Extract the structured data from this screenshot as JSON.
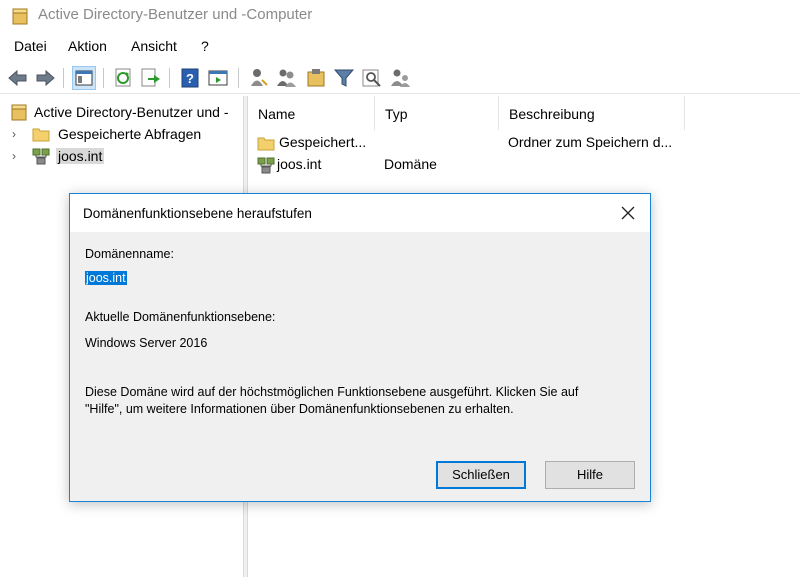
{
  "window": {
    "title": "Active Directory-Benutzer und -Computer"
  },
  "menu": {
    "items": [
      "Datei",
      "Aktion",
      "Ansicht",
      "?"
    ]
  },
  "toolbar": {
    "buttons": [
      "back-icon",
      "forward-icon",
      "show-console-tree-icon",
      "refresh-icon",
      "export-list-icon",
      "help-icon",
      "show-action-pane-icon",
      "create-user-icon",
      "create-group-icon",
      "create-ou-icon",
      "filter-icon",
      "find-icon",
      "add-to-group-icon"
    ]
  },
  "tree": {
    "root": "Active Directory-Benutzer und -",
    "items": [
      {
        "label": "Gespeicherte Abfragen"
      },
      {
        "label": "joos.int"
      }
    ]
  },
  "list": {
    "columns": [
      "Name",
      "Typ",
      "Beschreibung"
    ],
    "rows": [
      {
        "name": "Gespeichert...",
        "type": "",
        "description": "Ordner zum Speichern d..."
      },
      {
        "name": "joos.int",
        "type": "Domäne",
        "description": ""
      }
    ]
  },
  "dialog": {
    "title": "Domänenfunktionsebene heraufstufen",
    "domain_label": "Domänenname:",
    "domain_value": "joos.int",
    "level_label": "Aktuelle Domänenfunktionsebene:",
    "level_value": "Windows Server 2016",
    "info_line1": "Diese Domäne wird auf der höchstmöglichen Funktionsebene ausgeführt. Klicken Sie auf",
    "info_line2": "\"Hilfe\", um weitere Informationen über Domänenfunktionsebenen zu erhalten.",
    "close_label": "Schließen",
    "help_label": "Hilfe"
  }
}
